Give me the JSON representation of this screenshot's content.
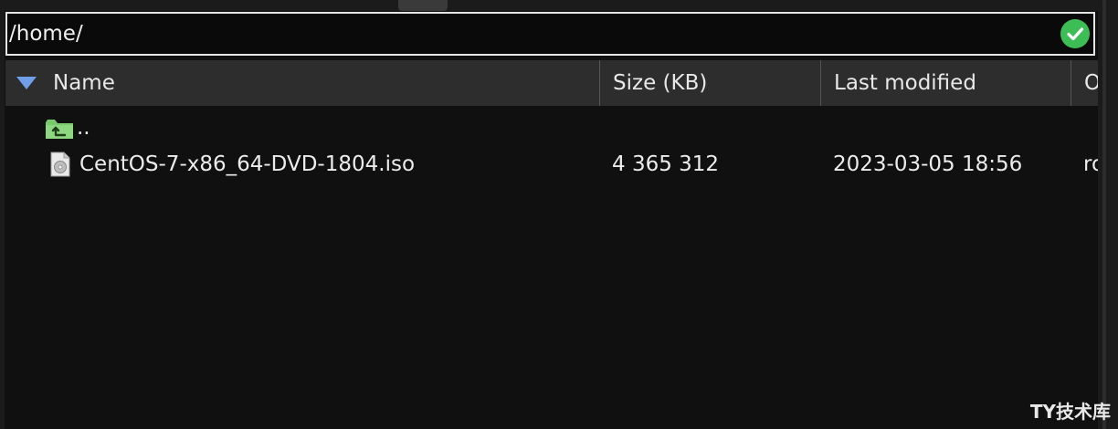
{
  "path_bar": {
    "value": "/home/",
    "valid_icon": "check-circle-icon",
    "valid_color": "#3dbd56"
  },
  "table": {
    "sort_icon": "sort-descending-triangle-icon",
    "columns": {
      "name": "Name",
      "size": "Size (KB)",
      "modified": "Last modified",
      "owner": "O"
    },
    "rows": [
      {
        "icon": "parent-folder-icon",
        "name": "..",
        "size": "",
        "modified": "",
        "owner": ""
      },
      {
        "icon": "disc-image-file-icon",
        "name": "CentOS-7-x86_64-DVD-1804.iso",
        "size": "4 365 312",
        "modified": "2023-03-05 18:56",
        "owner": "ro"
      }
    ]
  },
  "watermark": "TY技术库",
  "colors": {
    "background": "#101010",
    "header": "#2d2d2d",
    "sort_accent": "#6f9fe8",
    "folder_green": "#79c96d"
  }
}
